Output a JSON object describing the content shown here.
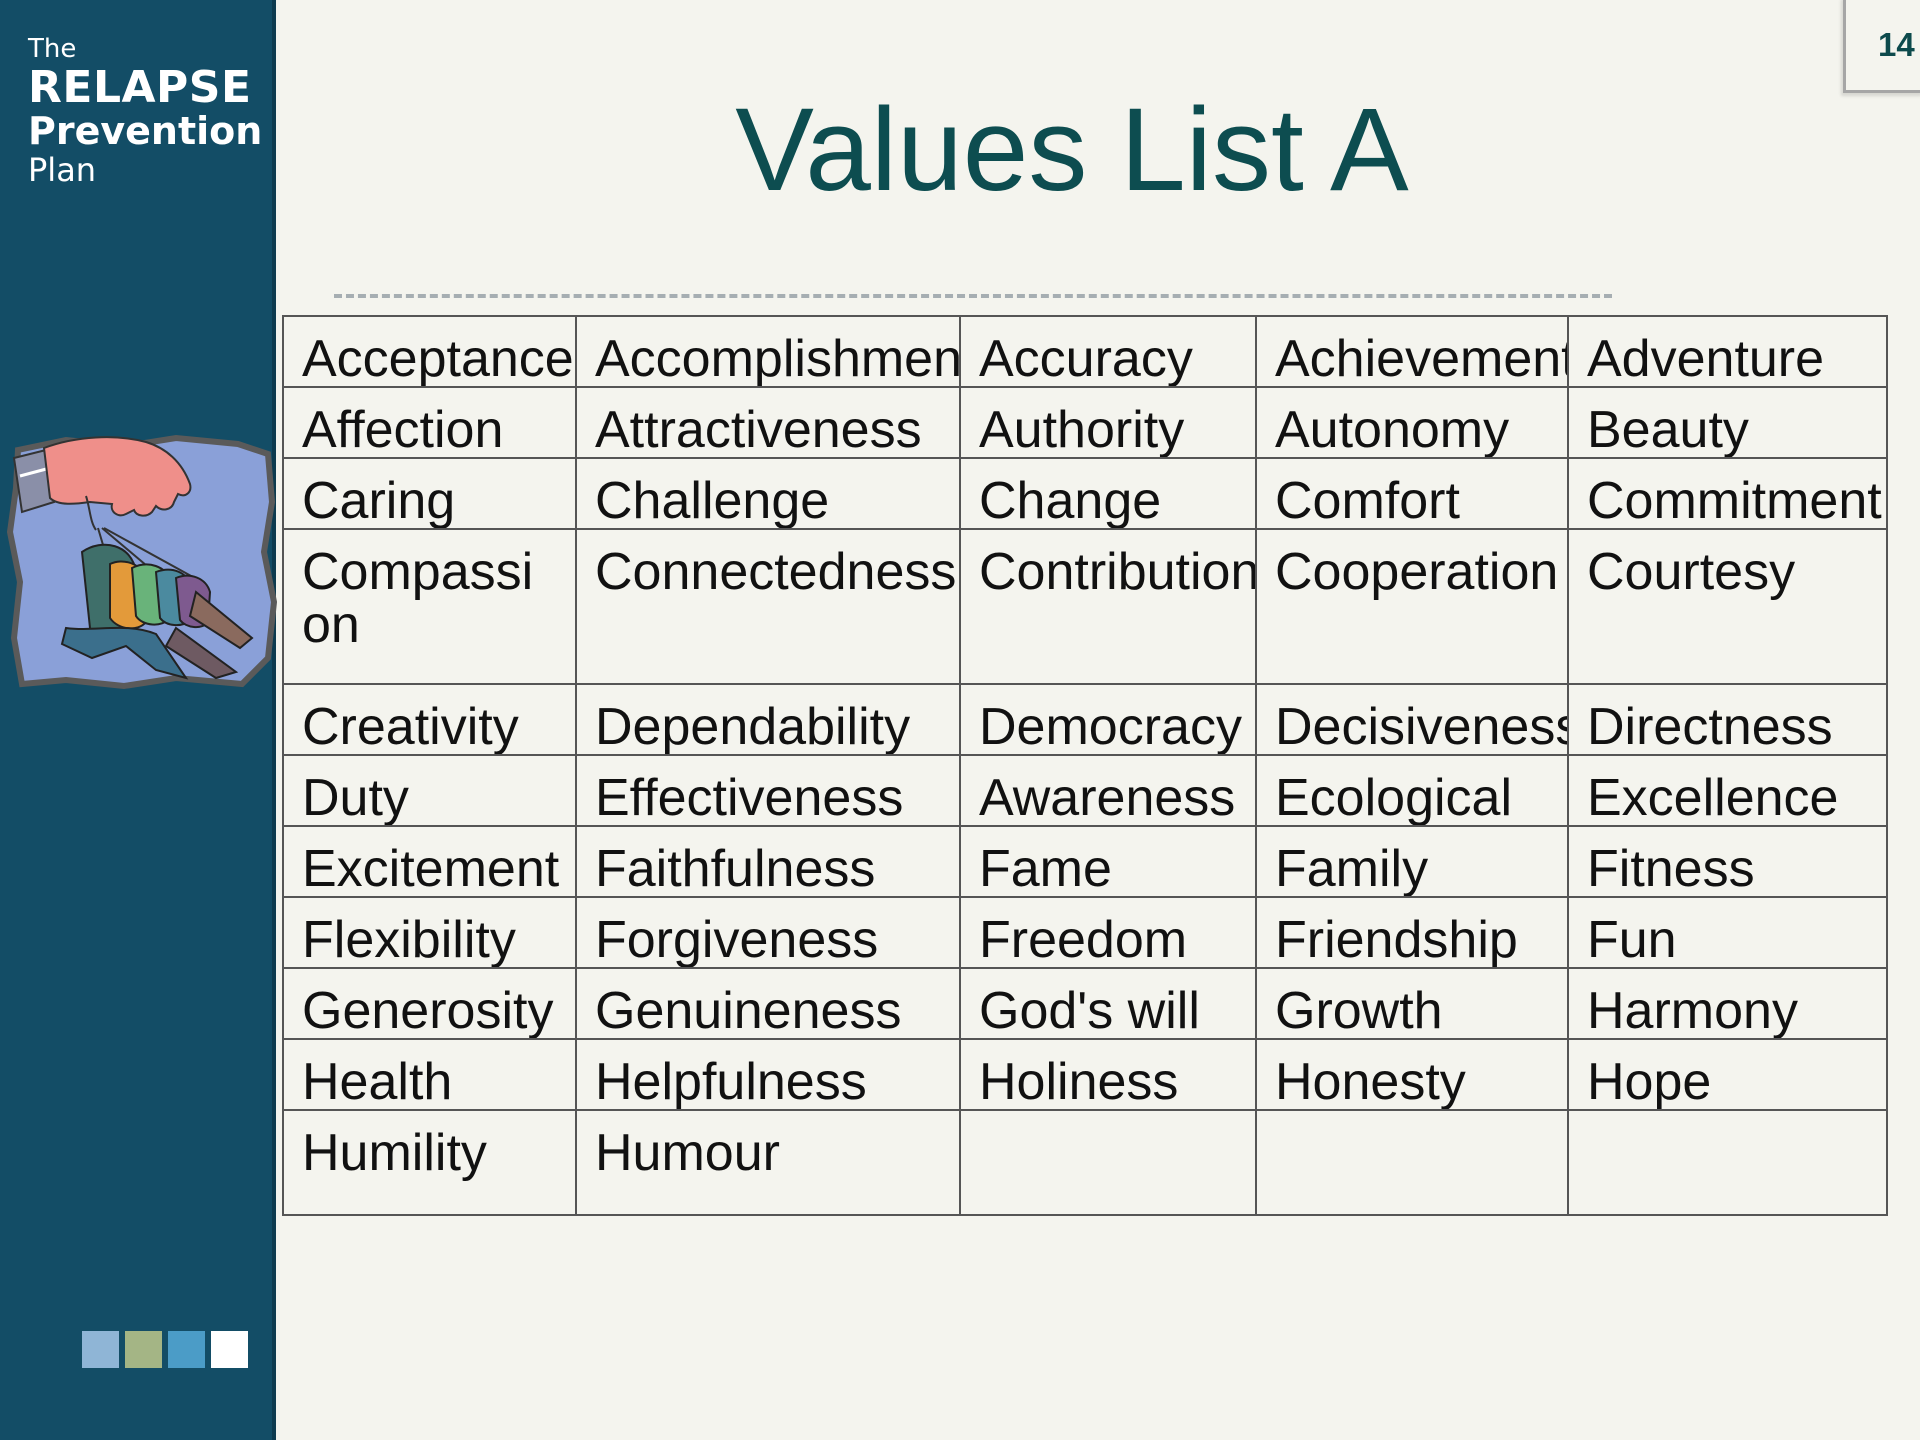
{
  "branding": {
    "line1": "The",
    "line2": "RELAPSE",
    "line3": "Prevention",
    "line4": "Plan"
  },
  "page_number": "14",
  "title": "Values List A",
  "clipart_icon": "hand-puppeteer-clipart",
  "colors": {
    "sidebar": "#134d66",
    "title": "#0d4d50",
    "background": "#f4f4ee",
    "squares": [
      "#8fb5d6",
      "#a4b585",
      "#4b9cc7",
      "#ffffff"
    ]
  },
  "values_table": {
    "rows": [
      [
        "Acceptance",
        "Accomplishment",
        "Accuracy",
        "Achievement",
        "Adventure"
      ],
      [
        "Affection",
        "Attractiveness",
        "Authority",
        "Autonomy",
        "Beauty"
      ],
      [
        "Caring",
        "Challenge",
        "Change",
        "Comfort",
        "Commitment"
      ],
      [
        "Compassion",
        "Connectedness",
        "Contribution",
        "Cooperation",
        "Courtesy"
      ],
      [
        "Creativity",
        "Dependability",
        "Democracy",
        "Decisiveness",
        "Directness"
      ],
      [
        "Duty",
        "Effectiveness",
        "Awareness",
        "Ecological",
        "Excellence"
      ],
      [
        "Excitement",
        "Faithfulness",
        "Fame",
        "Family",
        "Fitness"
      ],
      [
        "Flexibility",
        "Forgiveness",
        "Freedom",
        "Friendship",
        "Fun"
      ],
      [
        "Generosity",
        "Genuineness",
        "God's will",
        "Growth",
        "Harmony"
      ],
      [
        "Health",
        "Helpfulness",
        "Holiness",
        "Honesty",
        "Hope"
      ],
      [
        "Humility",
        "Humour",
        "",
        "",
        ""
      ]
    ]
  }
}
